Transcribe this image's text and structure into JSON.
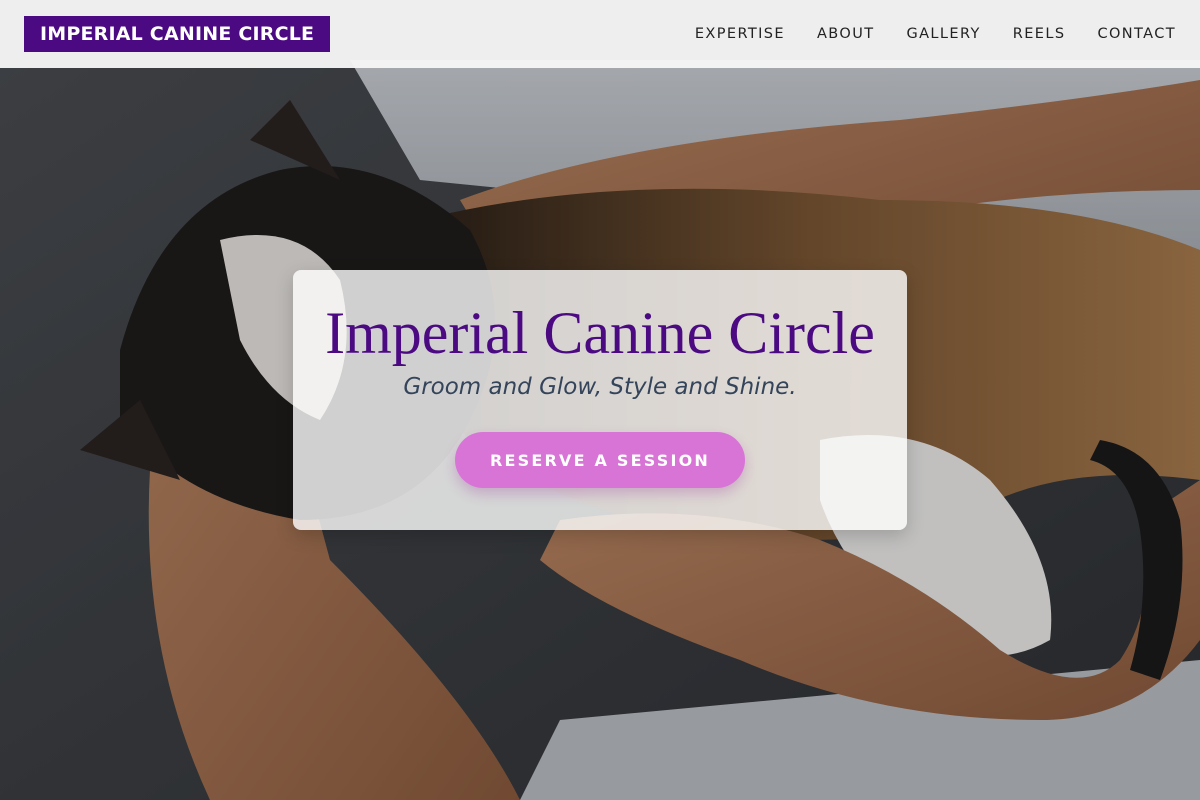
{
  "header": {
    "logo": "IMPERIAL CANINE CIRCLE",
    "nav": [
      "EXPERTISE",
      "ABOUT",
      "GALLERY",
      "REELS",
      "CONTACT"
    ]
  },
  "hero": {
    "image": "cat-held-in-arms-photo",
    "title": "Imperial Canine Circle",
    "tagline": "Groom and Glow, Style and Shine.",
    "cta_label": "RESERVE A SESSION"
  },
  "colors": {
    "brand": "#4b0a82",
    "cta": "#d774d6",
    "tagline": "#34445a",
    "header_bg": "#f6f6f7"
  }
}
